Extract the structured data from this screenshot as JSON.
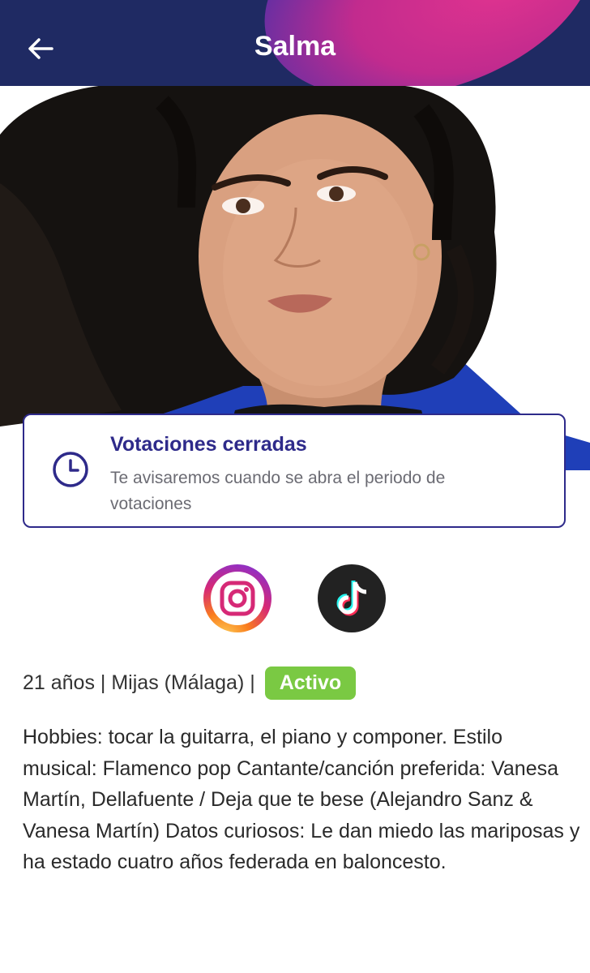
{
  "header": {
    "title": "Salma"
  },
  "vote_card": {
    "title": "Votaciones cerradas",
    "subtitle": "Te avisaremos cuando se abra el periodo de votaciones"
  },
  "social": [
    {
      "name": "Instagram",
      "icon": "instagram-icon"
    },
    {
      "name": "TikTok",
      "icon": "tiktok-icon"
    }
  ],
  "profile": {
    "info": "21 años | Mijas (Málaga) |",
    "status": "Activo",
    "bio": "Hobbies: tocar la guitarra, el piano y componer.    Estilo musical: Flamenco pop    Cantante/canción preferida: Vanesa Martín, Dellafuente / Deja que te bese (Alejandro Sanz & Vanesa Martín)    Datos curiosos: Le dan miedo las mariposas y ha estado cuatro años federada en baloncesto."
  },
  "colors": {
    "header_bg": "#1f2a63",
    "accent": "#2e2a8a",
    "status_badge": "#7ac943",
    "swoosh": "#e0338f"
  }
}
